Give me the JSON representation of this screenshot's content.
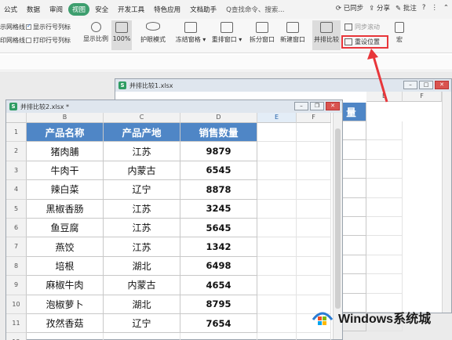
{
  "menu": {
    "tabs": [
      "公式",
      "数据",
      "审阅",
      "视图",
      "安全",
      "开发工具",
      "特色应用",
      "文档助手"
    ],
    "active_tab": "视图",
    "search": "Q查找命令、搜索...",
    "sync": "已同步",
    "share": "分享",
    "comment": "批注",
    "help": "?"
  },
  "ribbon": {
    "gridlines": "示网格线",
    "show_rowcol": "显示行号列标",
    "print_gridlines": "印网格线",
    "print_rowcol": "打印行号列标",
    "show_ratio": "显示比例",
    "zoom": "100%",
    "eye_mode": "护眼模式",
    "freeze": "冻结窗格",
    "rearrange": "重排窗口",
    "split": "拆分窗口",
    "new_window": "新建窗口",
    "side_by_side": "并排比较",
    "sync_scroll": "同步滚动",
    "reset_position": "重设位置",
    "macro": "宏"
  },
  "window_back": {
    "title": "并排比较1.xlsx",
    "col_e": "E",
    "col_f": "F",
    "partial_header": "量"
  },
  "window_front": {
    "title": "并排比较2.xlsx *",
    "columns": [
      "B",
      "C",
      "D",
      "E",
      "F"
    ],
    "rows": [
      "1",
      "2",
      "3",
      "4",
      "5",
      "6",
      "7",
      "8",
      "9",
      "10",
      "11",
      "12"
    ],
    "headers": [
      "产品名称",
      "产品产地",
      "销售数量"
    ],
    "data": [
      [
        "猪肉脯",
        "江苏",
        "9879"
      ],
      [
        "牛肉干",
        "内蒙古",
        "6545"
      ],
      [
        "辣白菜",
        "辽宁",
        "8878"
      ],
      [
        "黑椒香肠",
        "江苏",
        "3245"
      ],
      [
        "鱼豆腐",
        "江苏",
        "5645"
      ],
      [
        "燕饺",
        "江苏",
        "1342"
      ],
      [
        "培根",
        "湖北",
        "6498"
      ],
      [
        "麻椒牛肉",
        "内蒙古",
        "4654"
      ],
      [
        "泡椒萝卜",
        "湖北",
        "8795"
      ],
      [
        "孜然香菇",
        "辽宁",
        "7654"
      ]
    ]
  },
  "watermark": {
    "text": "Windows系统城"
  },
  "colors": {
    "accent_green": "#3d9e6e",
    "header_blue": "#4f86c6",
    "highlight_red": "#e8363a"
  }
}
